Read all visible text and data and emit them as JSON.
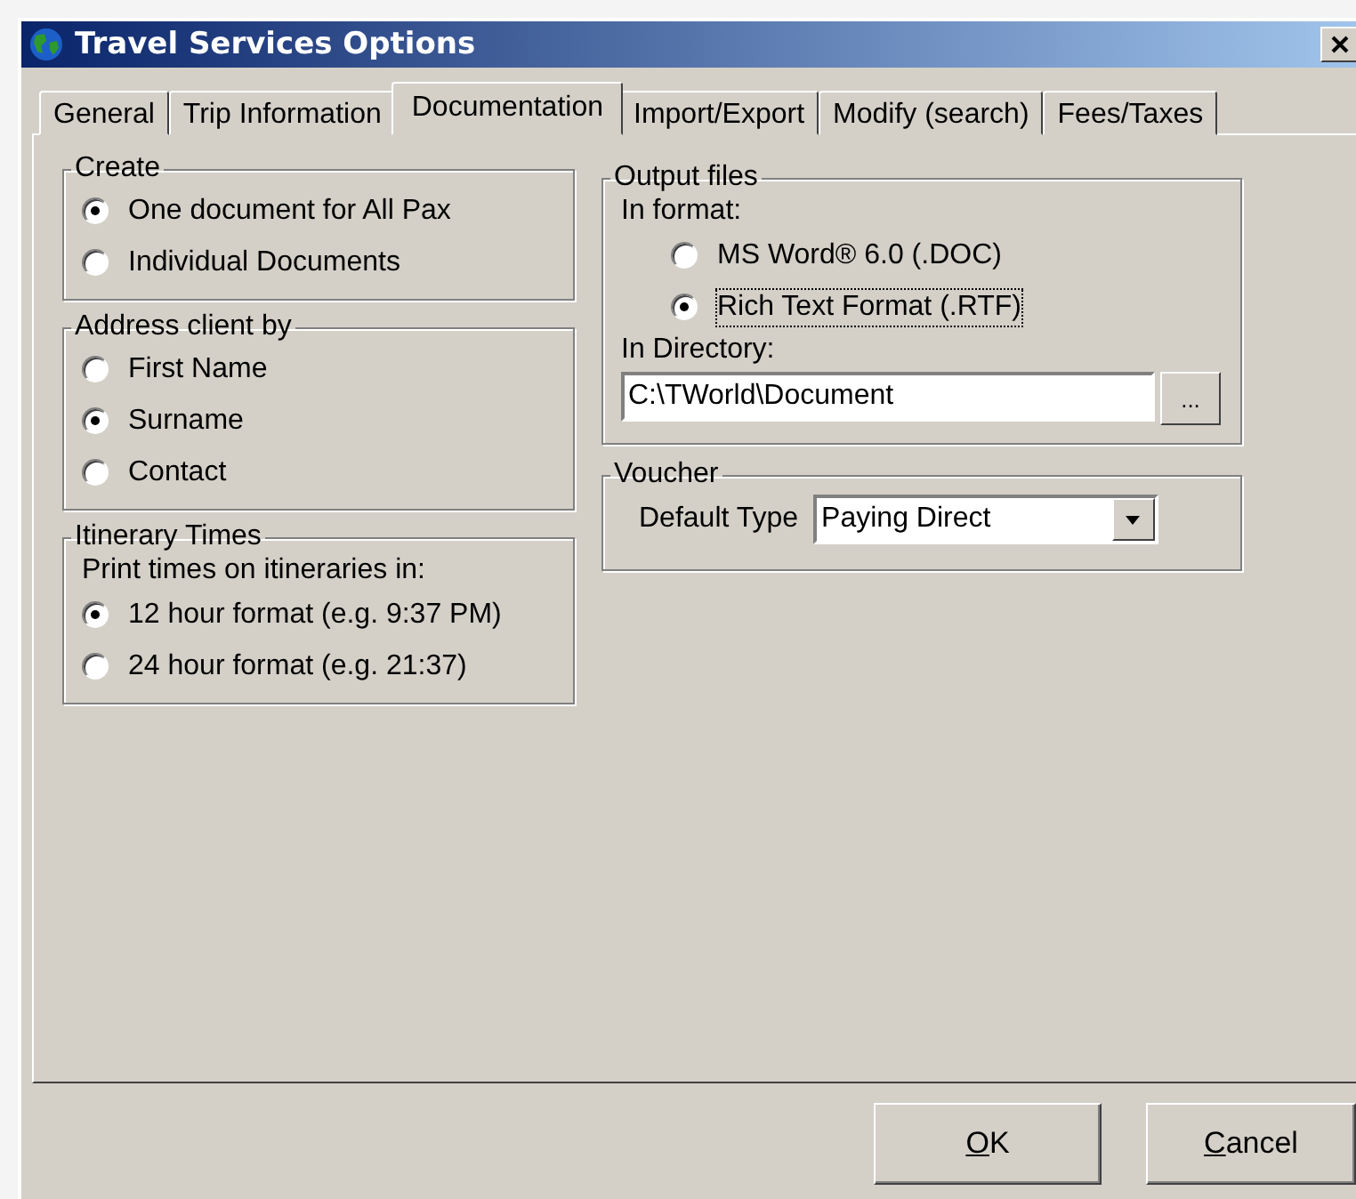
{
  "window": {
    "title": "Travel Services Options"
  },
  "tabs": [
    {
      "label": "General",
      "selected": false
    },
    {
      "label": "Trip Information",
      "selected": false
    },
    {
      "label": "Documentation",
      "selected": true
    },
    {
      "label": "Import/Export",
      "selected": false
    },
    {
      "label": "Modify (search)",
      "selected": false
    },
    {
      "label": "Fees/Taxes",
      "selected": false
    }
  ],
  "create": {
    "title": "Create",
    "options": [
      {
        "label": "One document for All Pax",
        "selected": true
      },
      {
        "label": "Individual Documents",
        "selected": false
      }
    ]
  },
  "address_client_by": {
    "title": "Address client by",
    "options": [
      {
        "label": "First Name",
        "selected": false
      },
      {
        "label": "Surname",
        "selected": true
      },
      {
        "label": "Contact",
        "selected": false
      }
    ]
  },
  "itinerary_times": {
    "title": "Itinerary Times",
    "prompt": "Print times on itineraries in:",
    "options": [
      {
        "label": "12 hour format (e.g. 9:37 PM)",
        "selected": true
      },
      {
        "label": "24 hour format (e.g. 21:37)",
        "selected": false
      }
    ]
  },
  "output_files": {
    "title": "Output files",
    "format_label": "In format:",
    "formats": [
      {
        "label": "MS Word® 6.0 (.DOC)",
        "selected": false,
        "focused": false
      },
      {
        "label": "Rich Text Format (.RTF)",
        "selected": true,
        "focused": true
      }
    ],
    "directory_label": "In Directory:",
    "directory": "C:\\TWorld\\Document",
    "browse_button": "..."
  },
  "voucher": {
    "title": "Voucher",
    "default_type_label": "Default Type",
    "default_type": "Paying Direct"
  },
  "buttons": [
    {
      "accelerator": "O",
      "rest": "K"
    },
    {
      "accelerator": "C",
      "rest": "ancel"
    }
  ]
}
